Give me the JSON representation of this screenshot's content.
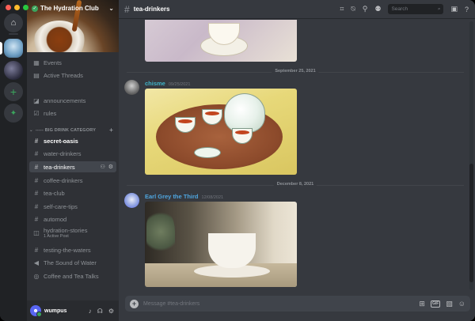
{
  "server": {
    "name": "The Hydration Club",
    "verified_glyph": "✓"
  },
  "sidebar": {
    "top_items": [
      {
        "label": "Events",
        "icon": "calendar-icon"
      },
      {
        "label": "Active Threads",
        "icon": "threads-icon"
      }
    ],
    "info_channels": [
      {
        "label": "announcements",
        "icon": "megaphone-icon"
      },
      {
        "label": "rules",
        "icon": "rules-icon"
      }
    ],
    "category": "----- BIG DRINK CATEGORY",
    "channels": [
      {
        "label": "secret-oasis",
        "state": "unread"
      },
      {
        "label": "water-drinkers",
        "state": "normal"
      },
      {
        "label": "tea-drinkers",
        "state": "selected"
      },
      {
        "label": "coffee-drinkers",
        "state": "normal"
      },
      {
        "label": "tea-club",
        "state": "normal"
      },
      {
        "label": "self-care-tips",
        "state": "normal"
      },
      {
        "label": "automod",
        "state": "normal"
      },
      {
        "label": "hydration-stories",
        "sub": "1 Active Post",
        "state": "normal"
      },
      {
        "label": "testing-the-waters",
        "state": "normal"
      },
      {
        "label": "The Sound of Water",
        "state": "normal"
      },
      {
        "label": "Coffee and Tea Talks",
        "state": "normal"
      }
    ]
  },
  "user": {
    "name": "wumpus"
  },
  "header": {
    "channel": "tea-drinkers",
    "search_placeholder": "Search"
  },
  "messages": {
    "divider1": "September 25, 2021",
    "divider2": "December 8, 2021",
    "msg1": {
      "author": "chisme",
      "date": "09/25/2021",
      "author_color": "#3fb3c8"
    },
    "msg2": {
      "author": "Earl Grey the Third",
      "date": "12/08/2021",
      "author_color": "#4fa6e0"
    }
  },
  "composer": {
    "placeholder": "Message #tea-drinkers",
    "gif_label": "GIF"
  },
  "colors": {
    "accent": "#5865f2",
    "online": "#3ba55d",
    "background": "#36393f",
    "sidebar": "#2f3136",
    "rail": "#202225"
  }
}
